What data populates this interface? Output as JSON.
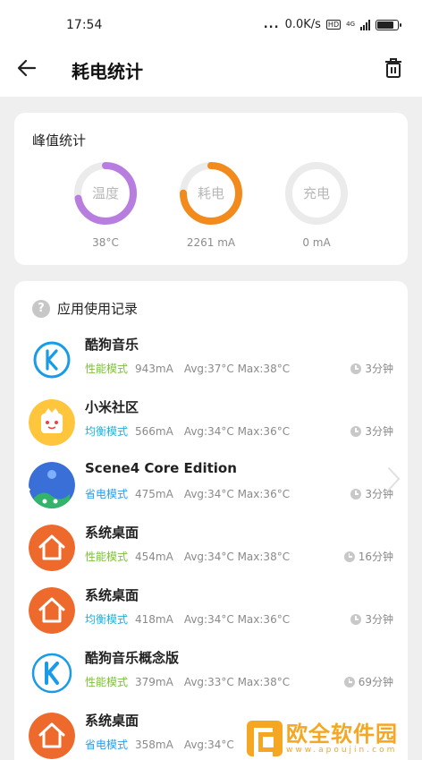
{
  "status_bar": {
    "time": "17:54",
    "dots": "...",
    "speed": "0.0K/s",
    "hd": "HD",
    "network": "4G"
  },
  "header": {
    "title": "耗电统计",
    "back_icon": "arrow-left-icon",
    "delete_icon": "trash-icon"
  },
  "peak": {
    "title": "峰值统计",
    "rings": [
      {
        "label": "温度",
        "value": "38°C",
        "color": "#b77ee0",
        "progress": 0.72
      },
      {
        "label": "耗电",
        "value": "2261 mA",
        "color": "#f28a1c",
        "progress": 0.75
      },
      {
        "label": "充电",
        "value": "0 mA",
        "color": "#ebebeb",
        "progress": 0
      }
    ]
  },
  "records": {
    "title": "应用使用记录",
    "help_icon": "?",
    "items": [
      {
        "name": "酷狗音乐",
        "mode": "性能模式",
        "mode_type": "perf",
        "current": "943mA",
        "avg": "Avg:37°C",
        "max": "Max:38°C",
        "duration": "3分钟",
        "icon": "kugou-icon"
      },
      {
        "name": "小米社区",
        "mode": "均衡模式",
        "mode_type": "bal",
        "current": "566mA",
        "avg": "Avg:34°C",
        "max": "Max:36°C",
        "duration": "3分钟",
        "icon": "mi-community-icon"
      },
      {
        "name": "Scene4 Core Edition",
        "mode": "省电模式",
        "mode_type": "save",
        "current": "475mA",
        "avg": "Avg:34°C",
        "max": "Max:36°C",
        "duration": "3分钟",
        "icon": "scene-icon"
      },
      {
        "name": "系统桌面",
        "mode": "性能模式",
        "mode_type": "perf",
        "current": "454mA",
        "avg": "Avg:34°C",
        "max": "Max:38°C",
        "duration": "16分钟",
        "icon": "home-icon"
      },
      {
        "name": "系统桌面",
        "mode": "均衡模式",
        "mode_type": "bal",
        "current": "418mA",
        "avg": "Avg:34°C",
        "max": "Max:36°C",
        "duration": "3分钟",
        "icon": "home-icon"
      },
      {
        "name": "酷狗音乐概念版",
        "mode": "性能模式",
        "mode_type": "perf",
        "current": "379mA",
        "avg": "Avg:33°C",
        "max": "Max:38°C",
        "duration": "69分钟",
        "icon": "kugou-concept-icon"
      },
      {
        "name": "系统桌面",
        "mode": "省电模式",
        "mode_type": "save",
        "current": "358mA",
        "avg": "Avg:34°C",
        "max": "",
        "duration": "",
        "icon": "home-icon"
      }
    ]
  },
  "watermark": {
    "text": "欧全软件园",
    "sub": "www.apoujin.com"
  }
}
